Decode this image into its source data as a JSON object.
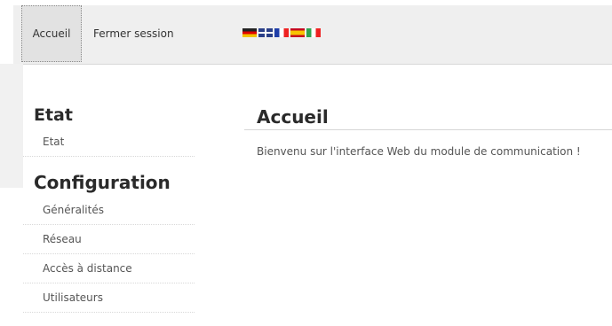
{
  "nav": {
    "home_label": "Accueil",
    "logout_label": "Fermer session",
    "flags": [
      "flag-de-icon",
      "flag-gb-icon",
      "flag-fr-icon",
      "flag-es-icon",
      "flag-it-icon"
    ]
  },
  "sidebar": {
    "etat": {
      "title": "Etat",
      "items": [
        {
          "label": "Etat"
        }
      ]
    },
    "configuration": {
      "title": "Configuration",
      "items": [
        {
          "label": "Généralités"
        },
        {
          "label": "Réseau"
        },
        {
          "label": "Accès à distance"
        },
        {
          "label": "Utilisateurs"
        }
      ]
    }
  },
  "main": {
    "title": "Accueil",
    "welcome": "Bienvenu sur l'interface Web du module de communication !"
  },
  "colors": {
    "navbar_bg": "#efefef",
    "text": "#2a2a2a",
    "muted_text": "#555555"
  }
}
